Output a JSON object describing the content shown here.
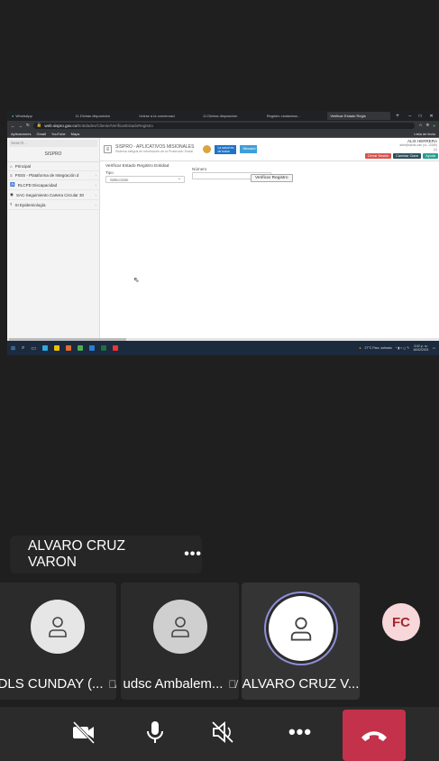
{
  "browser": {
    "tabs": [
      "WhatsApp",
      "11 Dichas disposicion",
      "Unirse a la conversaci",
      "11 Dichas disposicion",
      "Registro ciudadano -",
      "Verificar Estado Regis"
    ],
    "active_tab_index": 5,
    "url_host": "web.sispro.gov.co",
    "url_path": "/Entidades/Cliente/VerificarEstadoRegistro",
    "bookmarks": [
      "Aplicaciones",
      "Gmail",
      "YouTube",
      "Maps"
    ],
    "reading_list": "Lista de lectu"
  },
  "app": {
    "sidebar": {
      "search_placeholder": "Search...",
      "logo": "SISPRO",
      "items": [
        {
          "label": "Principal"
        },
        {
          "label": "PISIS - Plataforma de Integración d"
        },
        {
          "label": "RLCPD Discapacidad"
        },
        {
          "label": "SAC-Seguimiento Cartera Circular 30"
        },
        {
          "label": "SI Epidemiología"
        }
      ]
    },
    "header": {
      "title": "SISPRO - APLICATIVOS MISIONALES",
      "subtitle": "Sistema Integral de Información de la Protección Social",
      "ministry_logo": "La salud es de todos",
      "ministry_logo2": "Minsalud"
    },
    "user": {
      "name": "ALIX HERRERA",
      "email": "alixh@sionsi.com (cc. 12345)",
      "code": "(2)"
    },
    "buttons": {
      "close_session": "Cerrar Sesión",
      "change_key": "Cambiar Clave",
      "help": "Ayuda"
    },
    "form": {
      "title": "Verificar Estado Registro Entidad",
      "tipo_label": "Tipo",
      "tipo_value": "Seleccione",
      "numero_label": "Número",
      "numero_value": "",
      "verify_button": "Verificar Registro"
    }
  },
  "taskbar": {
    "weather": "27°C  Parc. soleado",
    "time": "3:02 p. m.",
    "date": "16/02/2021"
  },
  "meeting": {
    "presenter_name": "ALVARO CRUZ VARON",
    "participants": [
      {
        "name": "DLS CUNDAY (...",
        "muted": true
      },
      {
        "name": "udsc Ambalem...",
        "muted": true
      },
      {
        "name": "ALVARO CRUZ V...",
        "muted": false,
        "speaking": true
      },
      {
        "initials": "FC"
      }
    ],
    "speaking_ring_color": "#8f8fd6",
    "hangup_color": "#c4314b"
  }
}
